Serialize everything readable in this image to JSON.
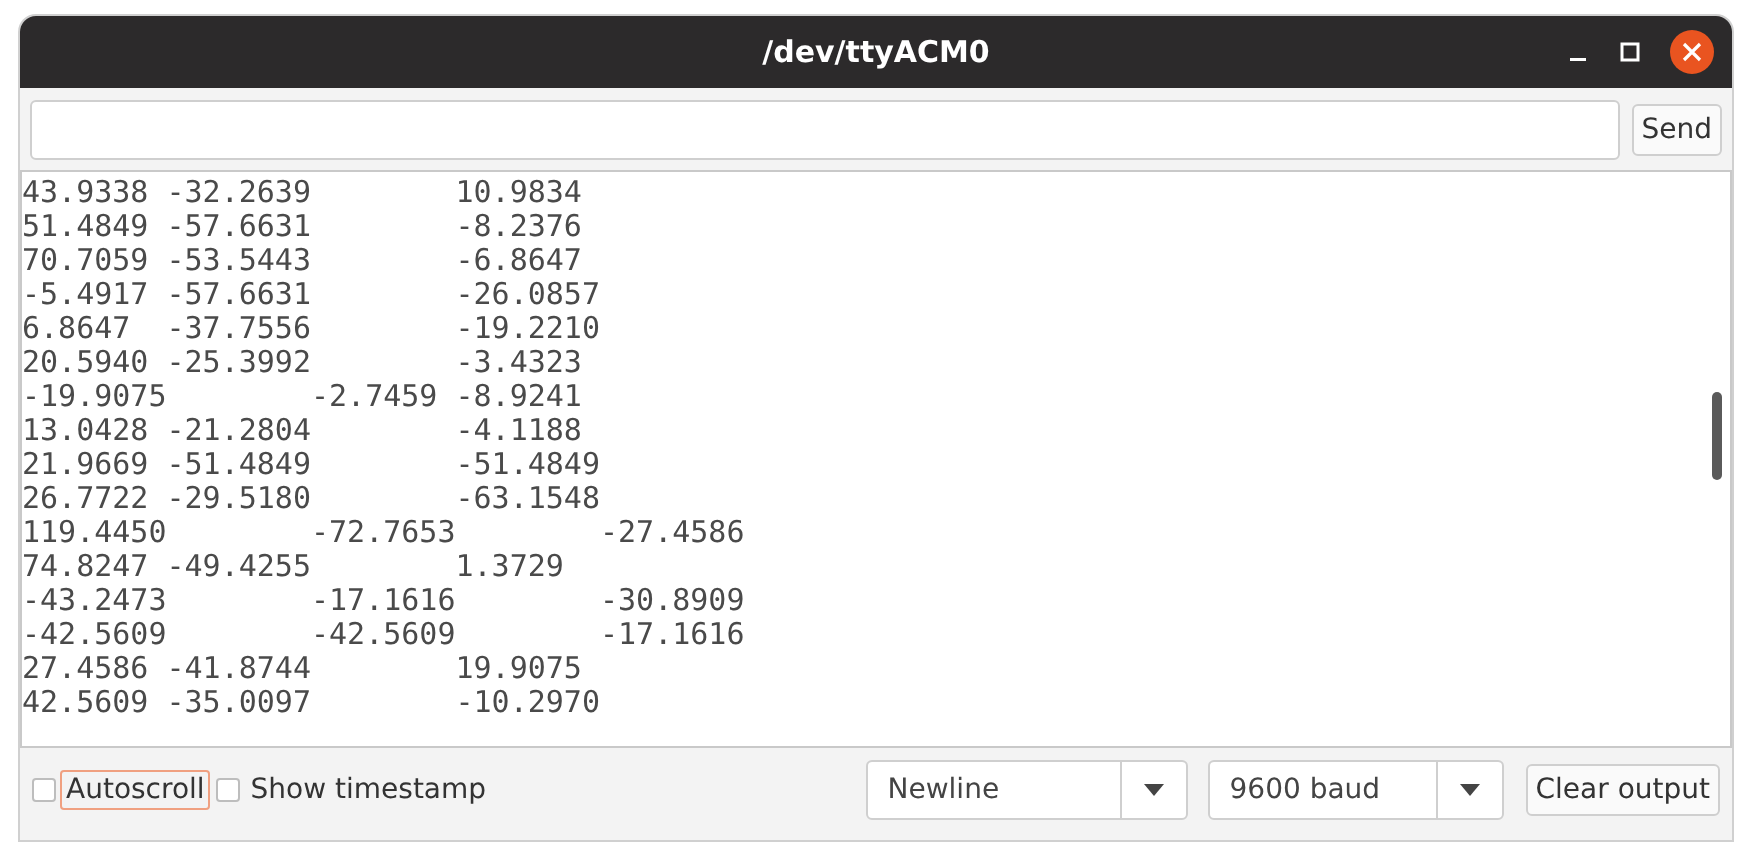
{
  "window": {
    "title": "/dev/ttyACM0"
  },
  "send_button": {
    "label": "Send"
  },
  "output": {
    "lines": [
      "43.9338 -32.2639\t10.9834",
      "51.4849 -57.6631\t-8.2376",
      "70.7059 -53.5443\t-6.8647",
      "-5.4917 -57.6631\t-26.0857",
      "6.8647  -37.7556\t-19.2210",
      "20.5940 -25.3992\t-3.4323",
      "-19.9075\t-2.7459 -8.9241",
      "13.0428 -21.2804\t-4.1188",
      "21.9669 -51.4849\t-51.4849",
      "26.7722 -29.5180\t-63.1548",
      "119.4450\t-72.7653\t-27.4586",
      "74.8247 -49.4255\t1.3729",
      "-43.2473\t-17.1616\t-30.8909",
      "-42.5609\t-42.5609\t-17.1616",
      "27.4586 -41.8744\t19.9075",
      "42.5609 -35.0097\t-10.2970"
    ]
  },
  "autoscroll": {
    "label": "Autoscroll",
    "checked": false,
    "focused": true
  },
  "show_timestamp": {
    "label": "Show timestamp",
    "checked": false
  },
  "line_ending": {
    "value": "Newline"
  },
  "baud_rate": {
    "value": "9600 baud"
  },
  "clear_button": {
    "label": "Clear output"
  }
}
